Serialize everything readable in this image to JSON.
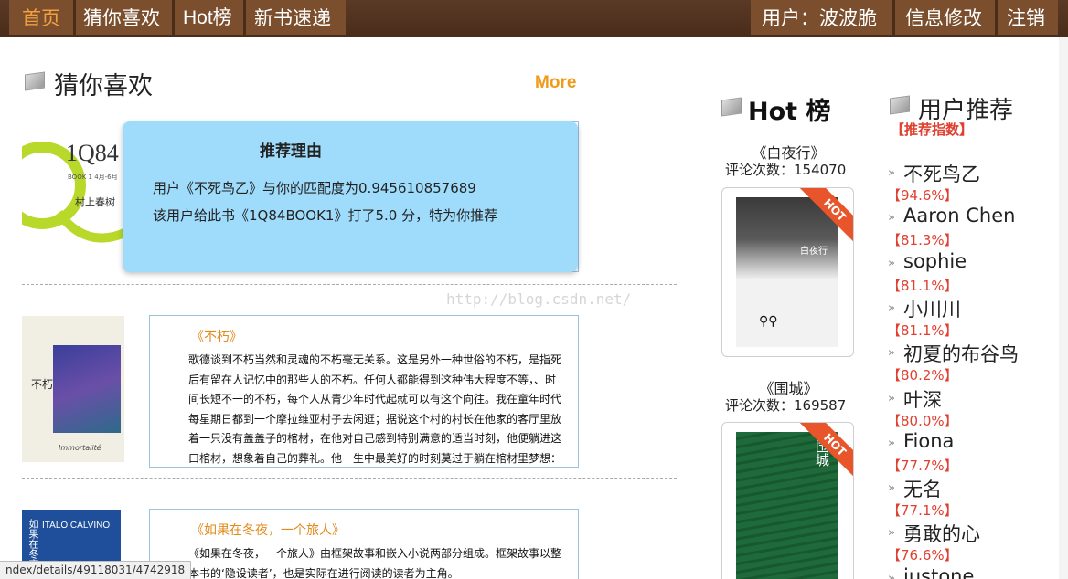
{
  "nav": {
    "home": "首页",
    "guess": "猜你喜欢",
    "hot": "Hot榜",
    "new_books": "新书速递",
    "user": "用户：波波脆",
    "edit": "信息修改",
    "logout": "注销"
  },
  "guess_section": {
    "title": "猜你喜欢",
    "more": "More",
    "books": [
      {
        "title": "《不朽》",
        "text": "歌德谈到不朽当然和灵魂的不朽毫无关系。这是另外一种世俗的不朽，是指死后有留在人记忆中的那些人的不朽。任何人都能得到这种伟大程度不等，、时间长短不一的不朽，每个人从青少年时代起就可以有这个向往。我在童年时代每星期日都到一个摩拉维亚村子去闲逛；据说这个村的村长在他家的客厅里放着一只没有盖盖子的棺材，在他对自己感到特别满意的适当时刻，他便躺进这口棺材，想象着自己的葬礼。他一生中最美好的时刻莫过于躺在棺材里梦想：这这样，他便住在他的不朽中。"
      },
      {
        "title": "《如果在冬夜，一个旅人》",
        "text": "《如果在冬夜，一个旅人》由框架故事和嵌入小说两部分组成。框架故事以整本书的‘隐设读者’，也是实际在进行阅读的读者为主角。"
      }
    ],
    "cover_texts": {
      "b1q84_title": "1Q84",
      "b1q84_sub": "BOOK 1  4月-6月",
      "b1q84_author": "村上春树",
      "buxiu_title": "不朽",
      "buxiu_sub": "Immortalité",
      "winter_title": "如果在冬夜",
      "winter_author": "ITALO CALVINO"
    }
  },
  "popup": {
    "title": "推荐理由",
    "line1": "用户《不死鸟乙》与你的匹配度为0.945610857689",
    "line2": "该用户给此书《1Q84BOOK1》打了5.0 分，特为你推荐"
  },
  "watermark": "http://blog.csdn.net/",
  "hot": {
    "title": "Hot 榜",
    "badge": "HOT",
    "books": [
      {
        "name": "《白夜行》",
        "count": "评论次数：154070",
        "cover": "白夜行"
      },
      {
        "name": "《围城》",
        "count": "评论次数：169587",
        "cover": "围城"
      }
    ]
  },
  "recs": {
    "title": "用户推荐",
    "subtitle": "【推荐指数】",
    "items": [
      {
        "name": "不死鸟乙",
        "pct": "【94.6%】"
      },
      {
        "name": "Aaron Chen",
        "pct": "【81.3%】"
      },
      {
        "name": "sophie",
        "pct": "【81.1%】"
      },
      {
        "name": "小川川",
        "pct": "【81.1%】"
      },
      {
        "name": "初夏的布谷鸟",
        "pct": "【80.2%】"
      },
      {
        "name": "叶深",
        "pct": "【80.0%】"
      },
      {
        "name": "Fiona",
        "pct": "【77.7%】"
      },
      {
        "name": "无名",
        "pct": "【77.1%】"
      },
      {
        "name": "勇敢的心",
        "pct": "【76.6%】"
      },
      {
        "name": "justone",
        "pct": ""
      }
    ]
  },
  "status": "ndex/details/49118031/4742918"
}
